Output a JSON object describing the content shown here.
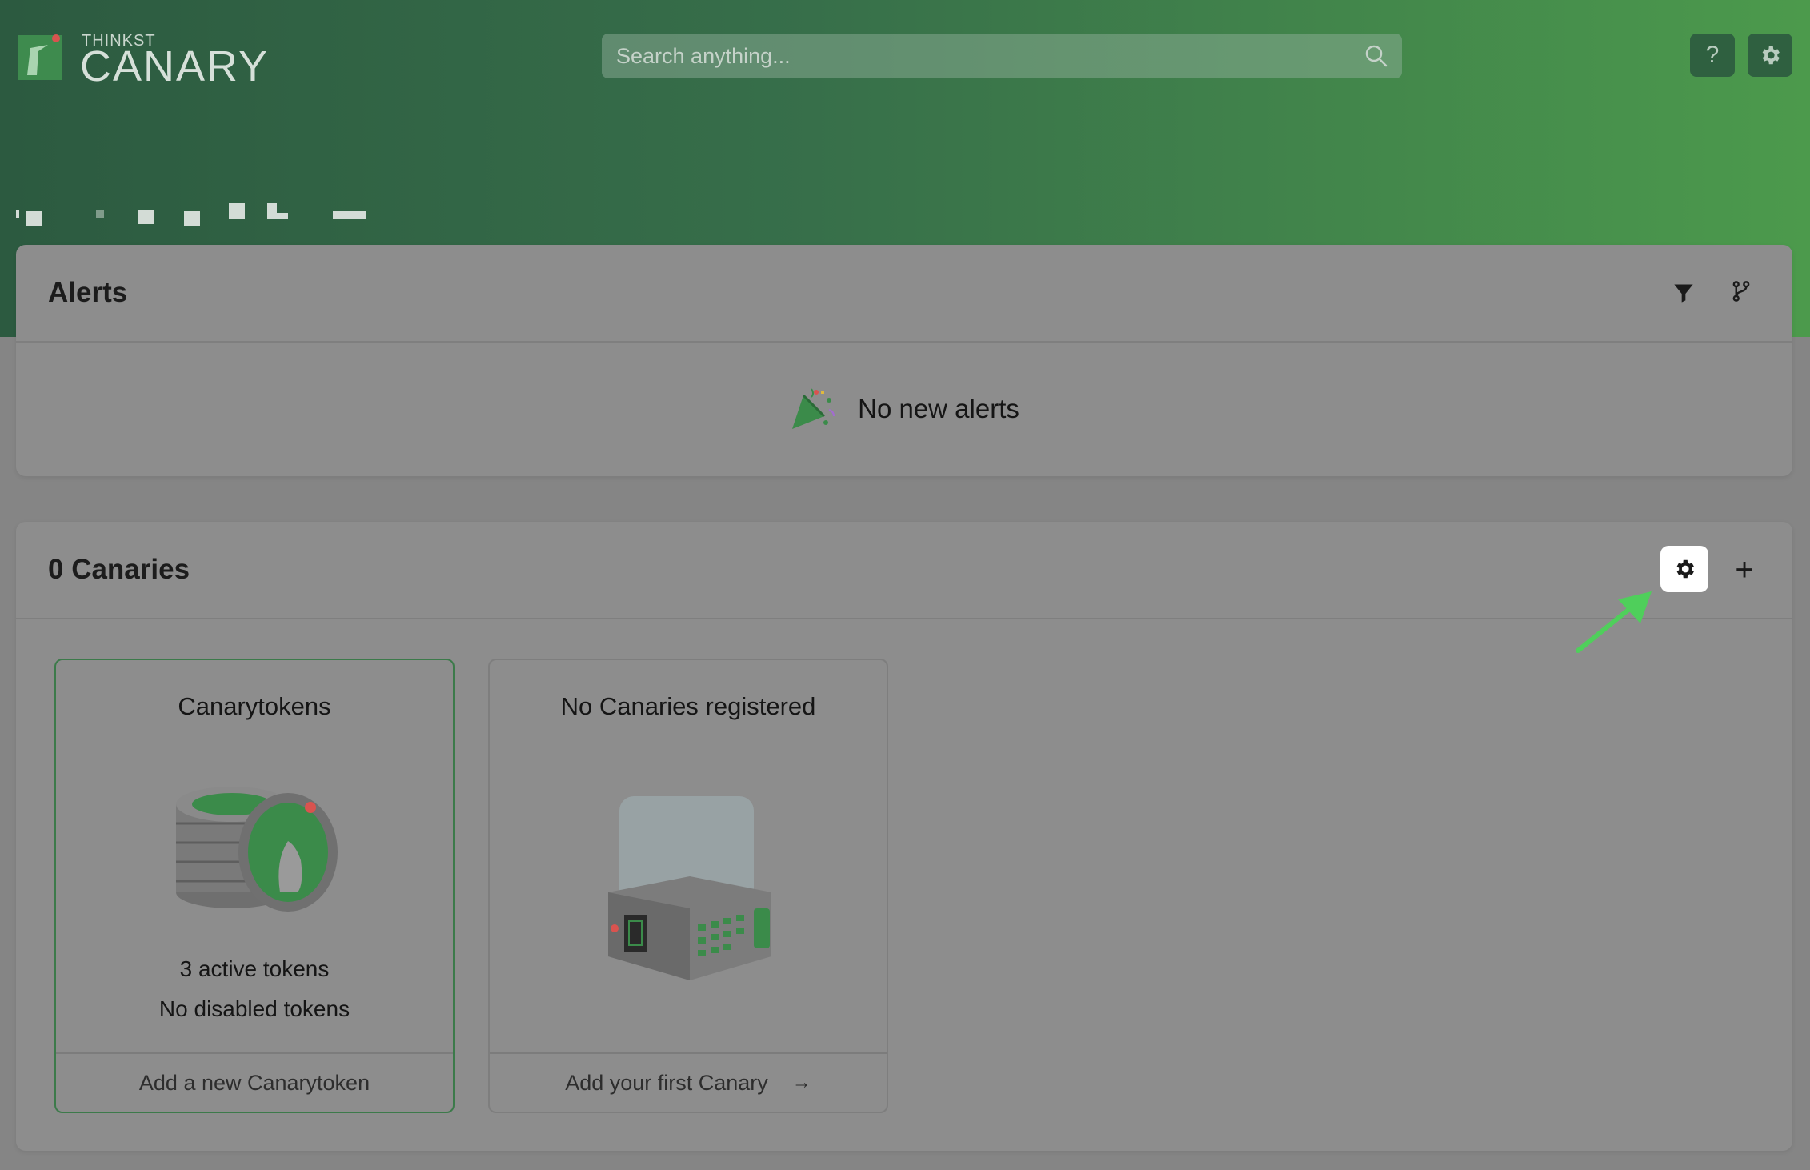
{
  "brand": {
    "sub": "THINKST",
    "name": "CANARY"
  },
  "search": {
    "placeholder": "Search anything..."
  },
  "header": {
    "help_label": "?"
  },
  "alerts": {
    "title": "Alerts",
    "empty_text": "No new alerts"
  },
  "canaries": {
    "title": "0 Canaries",
    "add_label": "+"
  },
  "tiles": [
    {
      "title": "Canarytokens",
      "line1": "3 active tokens",
      "line2": "No disabled tokens",
      "footer": "Add a new Canarytoken"
    },
    {
      "title": "No Canaries registered",
      "footer": "Add your first Canary",
      "footer_arrow": "→"
    }
  ],
  "colors": {
    "brand_green": "#3c7a4a",
    "annotation_arrow": "#4fcf5b"
  }
}
